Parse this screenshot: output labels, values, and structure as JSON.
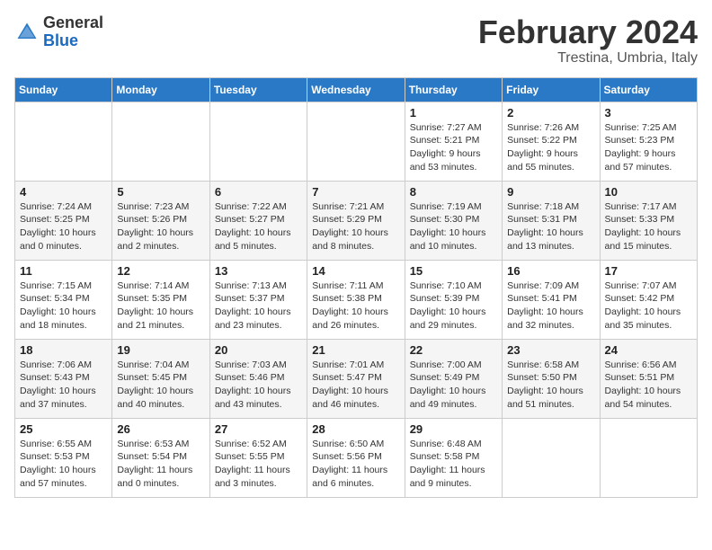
{
  "header": {
    "logo": {
      "general": "General",
      "blue": "Blue"
    },
    "title": "February 2024",
    "subtitle": "Trestina, Umbria, Italy"
  },
  "calendar": {
    "days_of_week": [
      "Sunday",
      "Monday",
      "Tuesday",
      "Wednesday",
      "Thursday",
      "Friday",
      "Saturday"
    ],
    "weeks": [
      [
        {
          "day": "",
          "info": ""
        },
        {
          "day": "",
          "info": ""
        },
        {
          "day": "",
          "info": ""
        },
        {
          "day": "",
          "info": ""
        },
        {
          "day": "1",
          "info": "Sunrise: 7:27 AM\nSunset: 5:21 PM\nDaylight: 9 hours\nand 53 minutes."
        },
        {
          "day": "2",
          "info": "Sunrise: 7:26 AM\nSunset: 5:22 PM\nDaylight: 9 hours\nand 55 minutes."
        },
        {
          "day": "3",
          "info": "Sunrise: 7:25 AM\nSunset: 5:23 PM\nDaylight: 9 hours\nand 57 minutes."
        }
      ],
      [
        {
          "day": "4",
          "info": "Sunrise: 7:24 AM\nSunset: 5:25 PM\nDaylight: 10 hours\nand 0 minutes."
        },
        {
          "day": "5",
          "info": "Sunrise: 7:23 AM\nSunset: 5:26 PM\nDaylight: 10 hours\nand 2 minutes."
        },
        {
          "day": "6",
          "info": "Sunrise: 7:22 AM\nSunset: 5:27 PM\nDaylight: 10 hours\nand 5 minutes."
        },
        {
          "day": "7",
          "info": "Sunrise: 7:21 AM\nSunset: 5:29 PM\nDaylight: 10 hours\nand 8 minutes."
        },
        {
          "day": "8",
          "info": "Sunrise: 7:19 AM\nSunset: 5:30 PM\nDaylight: 10 hours\nand 10 minutes."
        },
        {
          "day": "9",
          "info": "Sunrise: 7:18 AM\nSunset: 5:31 PM\nDaylight: 10 hours\nand 13 minutes."
        },
        {
          "day": "10",
          "info": "Sunrise: 7:17 AM\nSunset: 5:33 PM\nDaylight: 10 hours\nand 15 minutes."
        }
      ],
      [
        {
          "day": "11",
          "info": "Sunrise: 7:15 AM\nSunset: 5:34 PM\nDaylight: 10 hours\nand 18 minutes."
        },
        {
          "day": "12",
          "info": "Sunrise: 7:14 AM\nSunset: 5:35 PM\nDaylight: 10 hours\nand 21 minutes."
        },
        {
          "day": "13",
          "info": "Sunrise: 7:13 AM\nSunset: 5:37 PM\nDaylight: 10 hours\nand 23 minutes."
        },
        {
          "day": "14",
          "info": "Sunrise: 7:11 AM\nSunset: 5:38 PM\nDaylight: 10 hours\nand 26 minutes."
        },
        {
          "day": "15",
          "info": "Sunrise: 7:10 AM\nSunset: 5:39 PM\nDaylight: 10 hours\nand 29 minutes."
        },
        {
          "day": "16",
          "info": "Sunrise: 7:09 AM\nSunset: 5:41 PM\nDaylight: 10 hours\nand 32 minutes."
        },
        {
          "day": "17",
          "info": "Sunrise: 7:07 AM\nSunset: 5:42 PM\nDaylight: 10 hours\nand 35 minutes."
        }
      ],
      [
        {
          "day": "18",
          "info": "Sunrise: 7:06 AM\nSunset: 5:43 PM\nDaylight: 10 hours\nand 37 minutes."
        },
        {
          "day": "19",
          "info": "Sunrise: 7:04 AM\nSunset: 5:45 PM\nDaylight: 10 hours\nand 40 minutes."
        },
        {
          "day": "20",
          "info": "Sunrise: 7:03 AM\nSunset: 5:46 PM\nDaylight: 10 hours\nand 43 minutes."
        },
        {
          "day": "21",
          "info": "Sunrise: 7:01 AM\nSunset: 5:47 PM\nDaylight: 10 hours\nand 46 minutes."
        },
        {
          "day": "22",
          "info": "Sunrise: 7:00 AM\nSunset: 5:49 PM\nDaylight: 10 hours\nand 49 minutes."
        },
        {
          "day": "23",
          "info": "Sunrise: 6:58 AM\nSunset: 5:50 PM\nDaylight: 10 hours\nand 51 minutes."
        },
        {
          "day": "24",
          "info": "Sunrise: 6:56 AM\nSunset: 5:51 PM\nDaylight: 10 hours\nand 54 minutes."
        }
      ],
      [
        {
          "day": "25",
          "info": "Sunrise: 6:55 AM\nSunset: 5:53 PM\nDaylight: 10 hours\nand 57 minutes."
        },
        {
          "day": "26",
          "info": "Sunrise: 6:53 AM\nSunset: 5:54 PM\nDaylight: 11 hours\nand 0 minutes."
        },
        {
          "day": "27",
          "info": "Sunrise: 6:52 AM\nSunset: 5:55 PM\nDaylight: 11 hours\nand 3 minutes."
        },
        {
          "day": "28",
          "info": "Sunrise: 6:50 AM\nSunset: 5:56 PM\nDaylight: 11 hours\nand 6 minutes."
        },
        {
          "day": "29",
          "info": "Sunrise: 6:48 AM\nSunset: 5:58 PM\nDaylight: 11 hours\nand 9 minutes."
        },
        {
          "day": "",
          "info": ""
        },
        {
          "day": "",
          "info": ""
        }
      ]
    ]
  }
}
